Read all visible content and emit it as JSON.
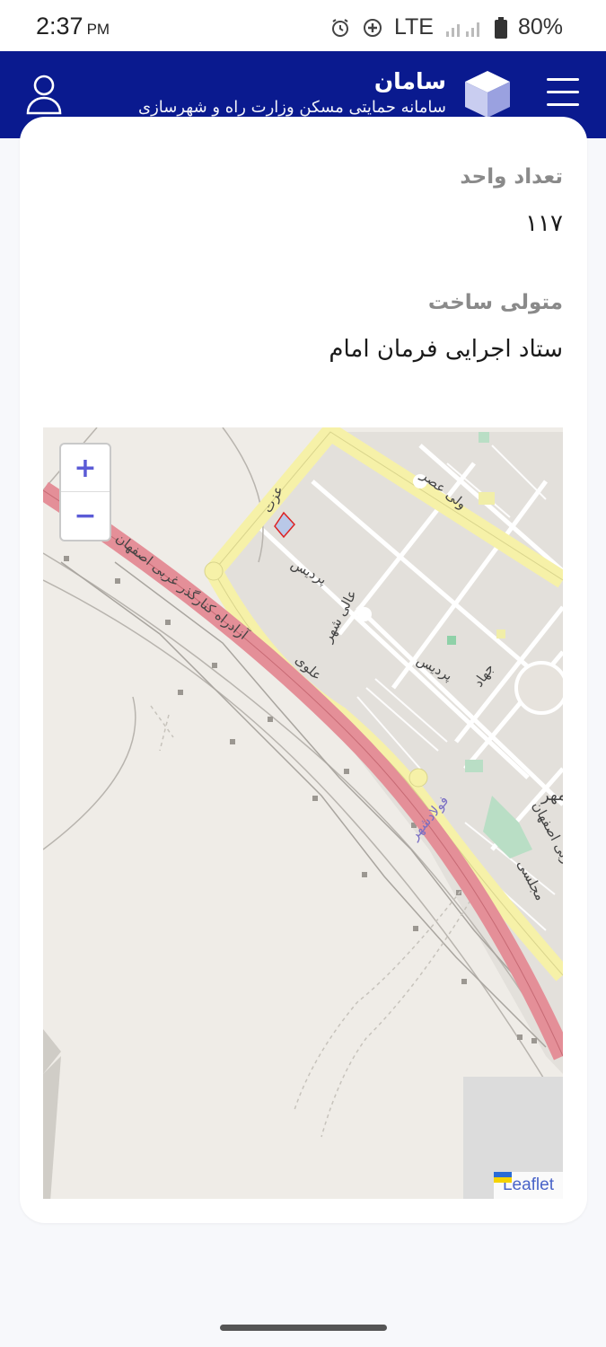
{
  "status_bar": {
    "time": "2:37",
    "ampm": "PM",
    "network": "LTE",
    "battery": "80%",
    "icons": [
      "alarm-icon",
      "data-saver-icon",
      "signal-icon",
      "battery-icon"
    ]
  },
  "header": {
    "title": "سامان",
    "subtitle": "سامانه حمایتی مسکن وزارت راه و شهرسازی",
    "brand_color": "#0a1a8f"
  },
  "fields": [
    {
      "label": "تعداد واحد",
      "value": "۱۱۷"
    },
    {
      "label": "متولی ساخت",
      "value": "ستاد اجرایی فرمان امام"
    }
  ],
  "map": {
    "zoom_in": "+",
    "zoom_out": "−",
    "attribution": "Leaflet",
    "labels": {
      "highway": "آزادراه کنارگذر غربی اصفهان",
      "highway_east": "کنارگذر غربی اصفهان",
      "ezzat": "عزت",
      "vali_asr": "ولی عصر",
      "pardis1": "پردیس",
      "pardis2": "پردیس",
      "ali_shahr": "عالی شهر",
      "alavi": "علوی",
      "jahad": "جهاد",
      "mehr": "مهر",
      "fooladshahr": "فولادشهر",
      "majlesi": "مجلسی"
    }
  }
}
